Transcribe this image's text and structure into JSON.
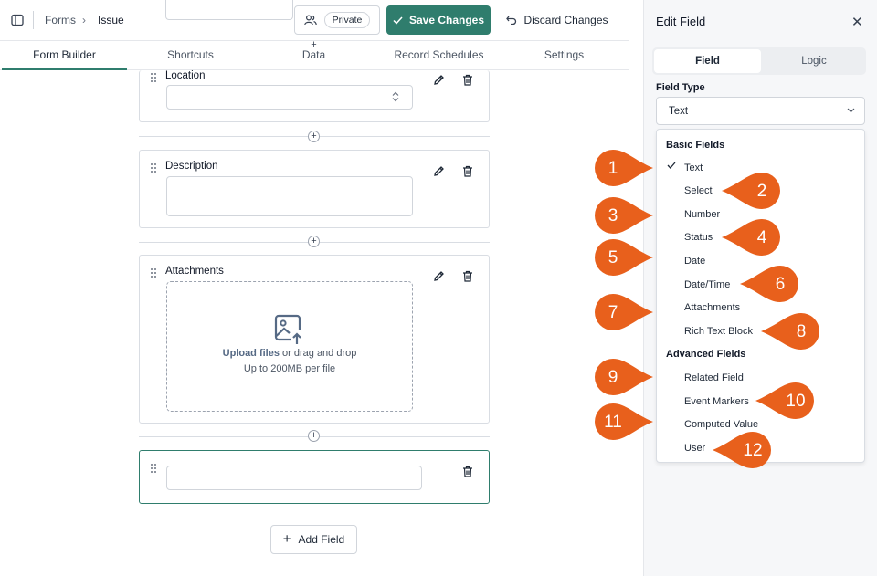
{
  "topbar": {
    "breadcrumb": [
      "Forms",
      "Issue"
    ],
    "visibility_label": "Private",
    "save_label": "Save Changes",
    "discard_label": "Discard Changes"
  },
  "tabs": [
    "Form Builder",
    "Shortcuts",
    "Data",
    "Record Schedules",
    "Settings"
  ],
  "fields": [
    {
      "label": "Location"
    },
    {
      "label": "Description"
    },
    {
      "label": "Attachments"
    }
  ],
  "upload": {
    "strong": "Upload files",
    "text": "or drag and drop",
    "limit": "Up to 200MB per file"
  },
  "add_field_label": "Add Field",
  "panel": {
    "title": "Edit Field",
    "tabs": [
      "Field",
      "Logic"
    ],
    "field_type_label": "Field Type",
    "field_type_value": "Text",
    "basic_heading": "Basic Fields",
    "basic_items": [
      "Text",
      "Select",
      "Number",
      "Status",
      "Date",
      "Date/Time",
      "Attachments",
      "Rich Text Block"
    ],
    "advanced_heading": "Advanced Fields",
    "advanced_items": [
      "Related Field",
      "Event Markers",
      "Computed Value",
      "User"
    ]
  },
  "markers": [
    "1",
    "2",
    "3",
    "4",
    "5",
    "6",
    "7",
    "8",
    "9",
    "10",
    "11",
    "12"
  ],
  "colors": {
    "accent": "#2f7d6d",
    "marker": "#e8601c"
  }
}
